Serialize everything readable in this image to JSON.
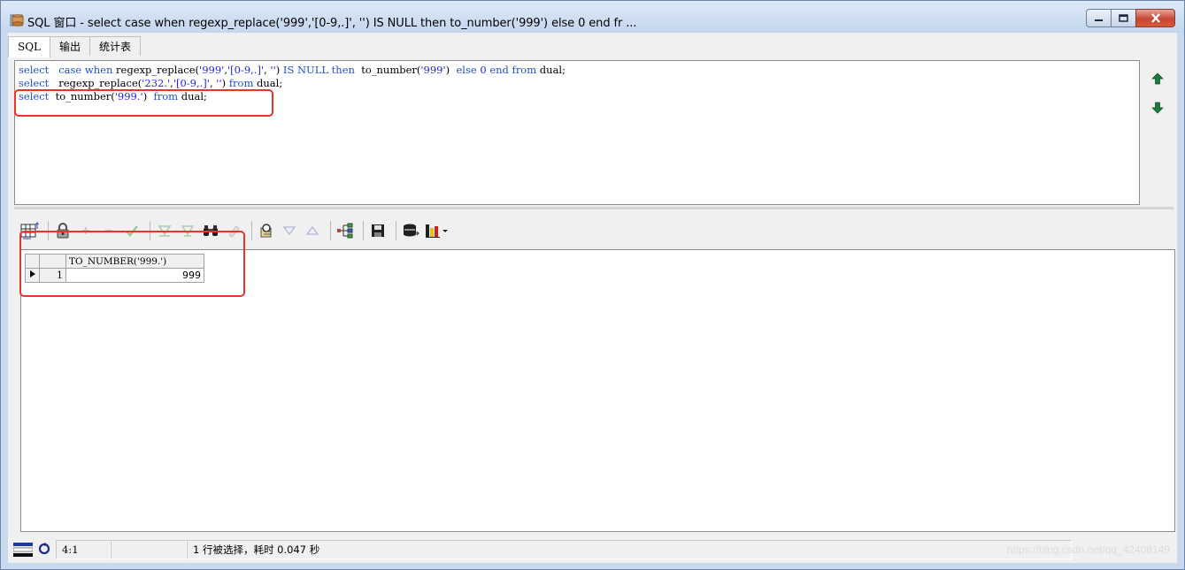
{
  "window": {
    "title": "SQL 窗口 - select case when regexp_replace('999','[0-9,.]', '') IS NULL then to_number('999') else 0 end fr ..."
  },
  "tabs": [
    {
      "label": "SQL"
    },
    {
      "label": "输出"
    },
    {
      "label": "统计表"
    }
  ],
  "editor": {
    "lines": [
      {
        "parts": [
          {
            "t": "kw",
            "v": "select"
          },
          {
            "t": "tx",
            "v": "   "
          },
          {
            "t": "kw",
            "v": "case"
          },
          {
            "t": "tx",
            "v": " "
          },
          {
            "t": "kw",
            "v": "when"
          },
          {
            "t": "tx",
            "v": " regexp_replace("
          },
          {
            "t": "str",
            "v": "'999'"
          },
          {
            "t": "tx",
            "v": ","
          },
          {
            "t": "str",
            "v": "'[0-9,.]'"
          },
          {
            "t": "tx",
            "v": ", "
          },
          {
            "t": "str",
            "v": "''"
          },
          {
            "t": "tx",
            "v": ") "
          },
          {
            "t": "kw",
            "v": "IS NULL then"
          },
          {
            "t": "tx",
            "v": "  to_number("
          },
          {
            "t": "str",
            "v": "'999'"
          },
          {
            "t": "tx",
            "v": ")  "
          },
          {
            "t": "kw",
            "v": "else"
          },
          {
            "t": "tx",
            "v": " "
          },
          {
            "t": "num",
            "v": "0"
          },
          {
            "t": "tx",
            "v": " "
          },
          {
            "t": "kw",
            "v": "end from"
          },
          {
            "t": "tx",
            "v": " dual;"
          }
        ]
      },
      {
        "parts": [
          {
            "t": "kw",
            "v": "select"
          },
          {
            "t": "tx",
            "v": "   regexp_replace("
          },
          {
            "t": "str",
            "v": "'232.'"
          },
          {
            "t": "tx",
            "v": ","
          },
          {
            "t": "str",
            "v": "'[0-9,.]'"
          },
          {
            "t": "tx",
            "v": ", "
          },
          {
            "t": "str",
            "v": "''"
          },
          {
            "t": "tx",
            "v": ") "
          },
          {
            "t": "kw",
            "v": "from"
          },
          {
            "t": "tx",
            "v": " dual;"
          }
        ]
      },
      {
        "parts": [
          {
            "t": "kw",
            "v": "select"
          },
          {
            "t": "tx",
            "v": "  to_number("
          },
          {
            "t": "str",
            "v": "'999.'"
          },
          {
            "t": "tx",
            "v": ")  "
          },
          {
            "t": "kw",
            "v": "from"
          },
          {
            "t": "tx",
            "v": " dual;"
          }
        ]
      }
    ]
  },
  "result_grid": {
    "columns": [
      "TO_NUMBER('999.')"
    ],
    "rows": [
      {
        "num": "1",
        "values": [
          "999"
        ]
      }
    ]
  },
  "statusbar": {
    "position": "4:1",
    "message": "1 行被选择，耗时 0.047 秒",
    "watermark": "https://blog.csdn.net/qq_42408149"
  },
  "colors": {
    "keyword": "#2050d0",
    "string": "#2020ff",
    "highlight": "#e8342c"
  }
}
